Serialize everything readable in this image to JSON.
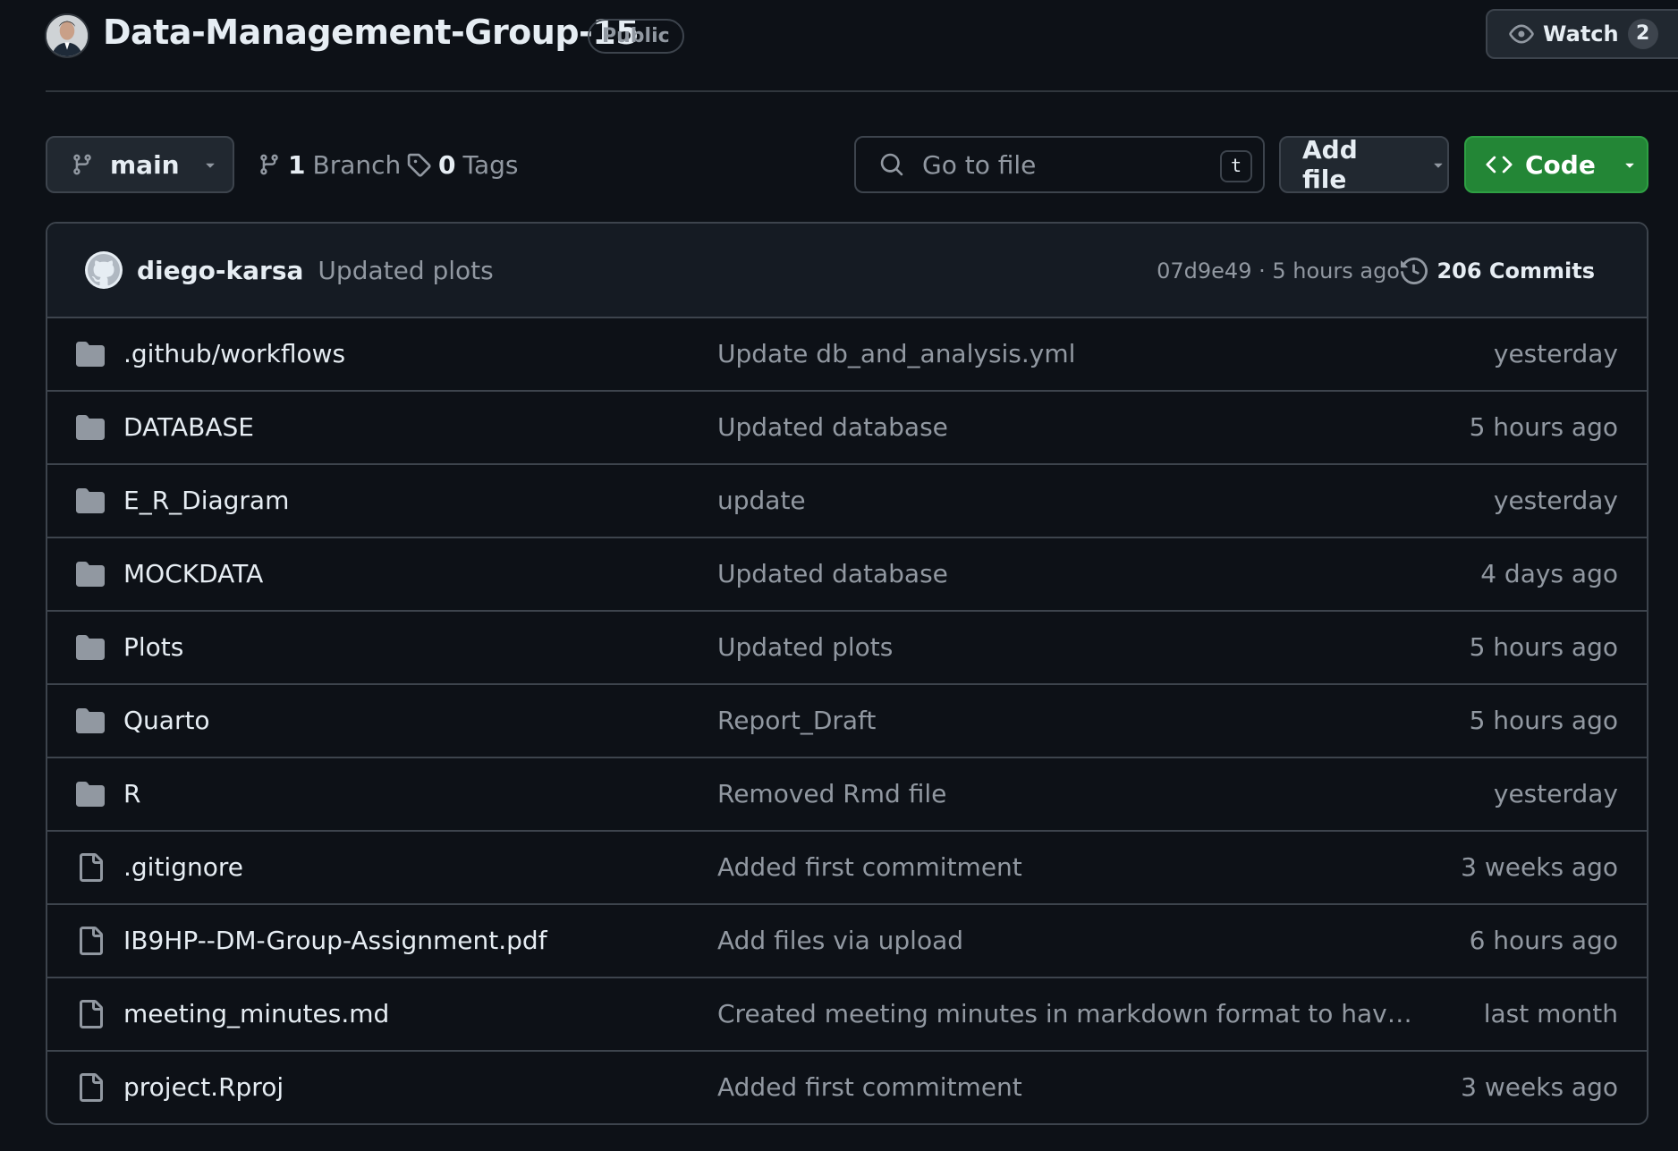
{
  "repo": {
    "name": "Data-Management-Group-15",
    "visibility": "Public"
  },
  "watch": {
    "label": "Watch",
    "count": "2"
  },
  "toolbar": {
    "branch": "main",
    "branches_count": "1",
    "branches_label": "Branch",
    "tags_count": "0",
    "tags_label": "Tags",
    "search_placeholder": "Go to file",
    "search_shortcut": "t",
    "add_file_label": "Add file",
    "code_label": "Code"
  },
  "latest_commit": {
    "author": "diego-karsa",
    "message": "Updated plots",
    "meta": "07d9e49 · 5 hours ago",
    "commits_label": "206 Commits"
  },
  "files": [
    {
      "type": "folder",
      "name": ".github/workflows",
      "commit": "Update db_and_analysis.yml",
      "time": "yesterday"
    },
    {
      "type": "folder",
      "name": "DATABASE",
      "commit": "Updated database",
      "time": "5 hours ago"
    },
    {
      "type": "folder",
      "name": "E_R_Diagram",
      "commit": "update",
      "time": "yesterday"
    },
    {
      "type": "folder",
      "name": "MOCKDATA",
      "commit": "Updated database",
      "time": "4 days ago"
    },
    {
      "type": "folder",
      "name": "Plots",
      "commit": "Updated plots",
      "time": "5 hours ago"
    },
    {
      "type": "folder",
      "name": "Quarto",
      "commit": "Report_Draft",
      "time": "5 hours ago"
    },
    {
      "type": "folder",
      "name": "R",
      "commit": "Removed Rmd file",
      "time": "yesterday"
    },
    {
      "type": "file",
      "name": ".gitignore",
      "commit": "Added first commitment",
      "time": "3 weeks ago"
    },
    {
      "type": "file",
      "name": "IB9HP--DM-Group-Assignment.pdf",
      "commit": "Add files via upload",
      "time": "6 hours ago"
    },
    {
      "type": "file",
      "name": "meeting_minutes.md",
      "commit": "Created meeting minutes in markdown format to have it rea...",
      "time": "last month"
    },
    {
      "type": "file",
      "name": "project.Rproj",
      "commit": "Added first commitment",
      "time": "3 weeks ago"
    }
  ]
}
